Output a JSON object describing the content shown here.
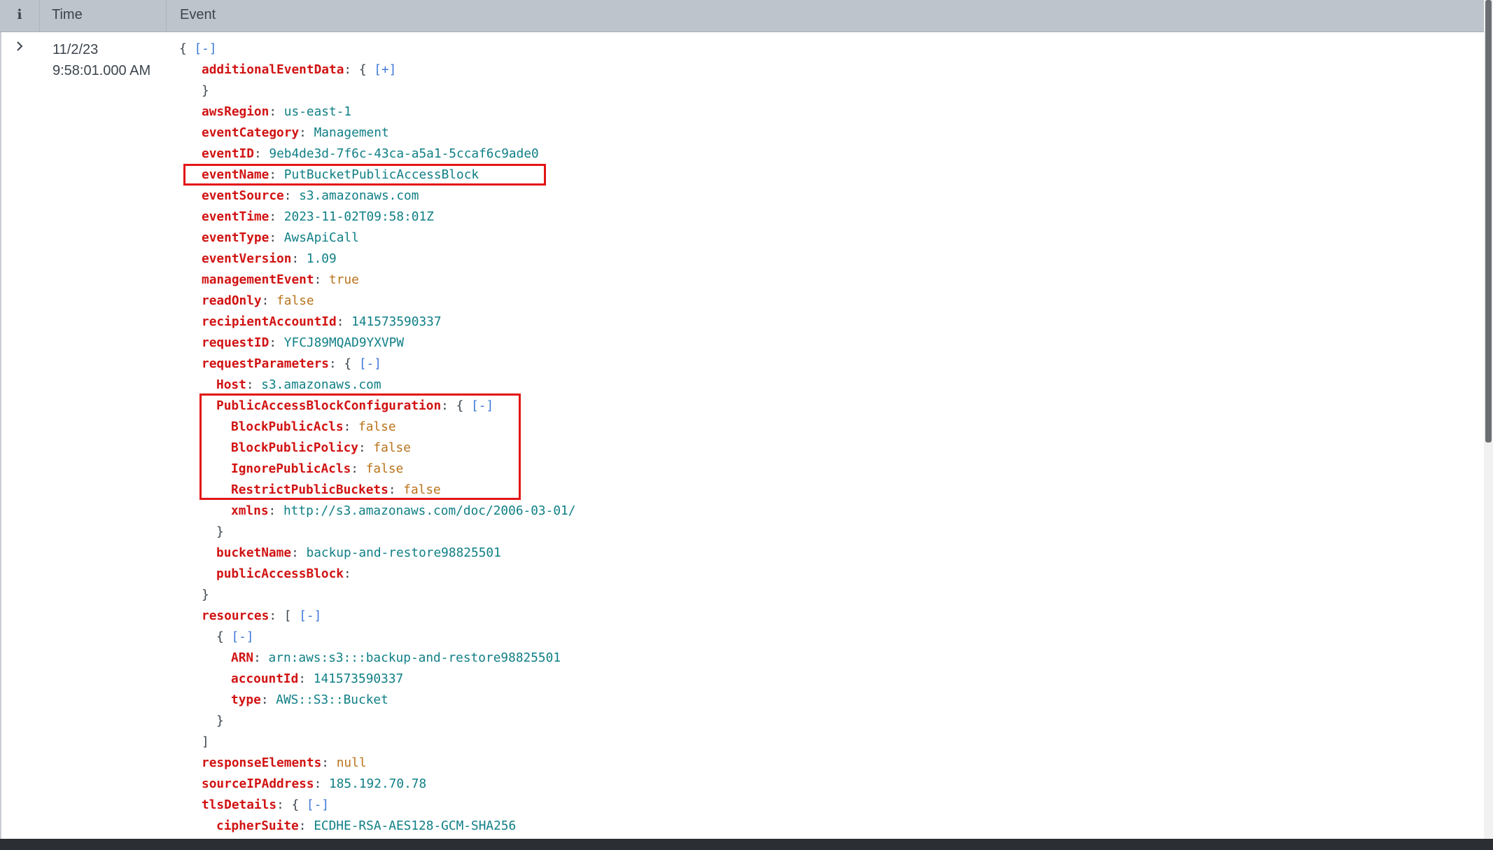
{
  "header": {
    "info_label": "i",
    "time_label": "Time",
    "event_label": "Event"
  },
  "event_row": {
    "date": "11/2/23",
    "time": "9:58:01.000 AM"
  },
  "json_view": {
    "root_open": "{",
    "root_toggle": "[-]",
    "additionalEventData": {
      "key": "additionalEventData",
      "open": "{",
      "toggle": "[+]",
      "close": "}"
    },
    "awsRegion": {
      "key": "awsRegion",
      "value": "us-east-1"
    },
    "eventCategory": {
      "key": "eventCategory",
      "value": "Management"
    },
    "eventID": {
      "key": "eventID",
      "value": "9eb4de3d-7f6c-43ca-a5a1-5ccaf6c9ade0"
    },
    "eventName": {
      "key": "eventName",
      "value": "PutBucketPublicAccessBlock"
    },
    "eventSource": {
      "key": "eventSource",
      "value": "s3.amazonaws.com"
    },
    "eventTime": {
      "key": "eventTime",
      "value": "2023-11-02T09:58:01Z"
    },
    "eventType": {
      "key": "eventType",
      "value": "AwsApiCall"
    },
    "eventVersion": {
      "key": "eventVersion",
      "value": "1.09"
    },
    "managementEvent": {
      "key": "managementEvent",
      "value": "true"
    },
    "readOnly": {
      "key": "readOnly",
      "value": "false"
    },
    "recipientAccountId": {
      "key": "recipientAccountId",
      "value": "141573590337"
    },
    "requestID": {
      "key": "requestID",
      "value": "YFCJ89MQAD9YXVPW"
    },
    "requestParameters": {
      "key": "requestParameters",
      "open": "{",
      "toggle": "[-]",
      "close": "}",
      "Host": {
        "key": "Host",
        "value": "s3.amazonaws.com"
      },
      "PublicAccessBlockConfiguration": {
        "key": "PublicAccessBlockConfiguration",
        "open": "{",
        "toggle": "[-]",
        "close": "}",
        "BlockPublicAcls": {
          "key": "BlockPublicAcls",
          "value": "false"
        },
        "BlockPublicPolicy": {
          "key": "BlockPublicPolicy",
          "value": "false"
        },
        "IgnorePublicAcls": {
          "key": "IgnorePublicAcls",
          "value": "false"
        },
        "RestrictPublicBuckets": {
          "key": "RestrictPublicBuckets",
          "value": "false"
        },
        "xmlns": {
          "key": "xmlns",
          "value": "http://s3.amazonaws.com/doc/2006-03-01/"
        }
      },
      "bucketName": {
        "key": "bucketName",
        "value": "backup-and-restore98825501"
      },
      "publicAccessBlock": {
        "key": "publicAccessBlock",
        "value": ""
      }
    },
    "resources": {
      "key": "resources",
      "open": "[",
      "toggle": "[-]",
      "close": "]",
      "item_open": "{",
      "item_toggle": "[-]",
      "item_close": "}",
      "ARN": {
        "key": "ARN",
        "value": "arn:aws:s3:::backup-and-restore98825501"
      },
      "accountId": {
        "key": "accountId",
        "value": "141573590337"
      },
      "type": {
        "key": "type",
        "value": "AWS::S3::Bucket"
      }
    },
    "responseElements": {
      "key": "responseElements",
      "value": "null"
    },
    "sourceIPAddress": {
      "key": "sourceIPAddress",
      "value": "185.192.70.78"
    },
    "tlsDetails": {
      "key": "tlsDetails",
      "open": "{",
      "toggle": "[-]",
      "cipherSuite": {
        "key": "cipherSuite",
        "value": "ECDHE-RSA-AES128-GCM-SHA256"
      }
    }
  },
  "colors": {
    "key": "#d11313",
    "string": "#0f7f86",
    "literal": "#b9731a",
    "toggle": "#3d78d6",
    "highlight": "#e31515"
  }
}
